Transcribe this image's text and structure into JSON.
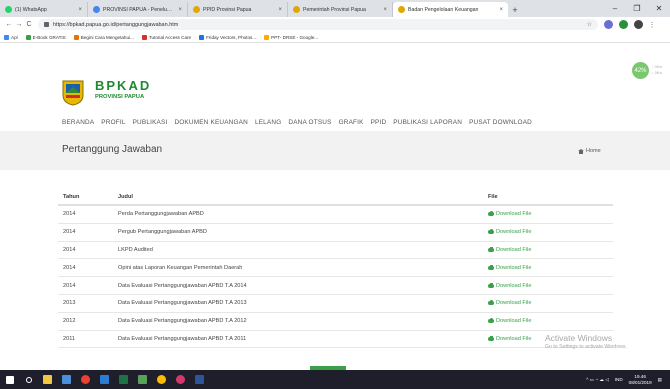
{
  "browser": {
    "tabs": [
      {
        "label": "(1) WhatsApp",
        "favicon_color": "#25d366",
        "active": false
      },
      {
        "label": "PROVINSI PAPUA - Penelusuran",
        "favicon_color": "#4285f4",
        "active": false
      },
      {
        "label": "PPID Provinsi Papua",
        "favicon_color": "#e0a800",
        "active": false
      },
      {
        "label": "Pemerintah Provinsi Papua",
        "favicon_color": "#e0a800",
        "active": false
      },
      {
        "label": "Badan Pengelolaan Keuangan",
        "favicon_color": "#e0a800",
        "active": true
      }
    ],
    "new_tab": "+",
    "url": "https://bpkad.papua.go.id/pertanggungjawaban.htm",
    "bookmarks": [
      {
        "label": "Apl",
        "color": "#4285f4"
      },
      {
        "label": "E-Book GRATIS",
        "color": "#3aa14a"
      },
      {
        "label": "Begini Cara Mengetahui...",
        "color": "#e8710a"
      },
      {
        "label": "Tutorial Access Care",
        "color": "#d93025"
      },
      {
        "label": "Friday Vectors, Photos...",
        "color": "#1a73e8"
      },
      {
        "label": "PPT- DRSE - Google...",
        "color": "#f9ab00"
      }
    ]
  },
  "site": {
    "logo_title": "BPKAD",
    "logo_subtitle": "PROVINSI PAPUA",
    "menu": [
      "BERANDA",
      "PROFIL",
      "PUBLIKASI",
      "DOKUMEN KEUANGAN",
      "LELANG",
      "DANA OTSUS",
      "GRAFIK",
      "PPID",
      "PUBLIKASI LAPORAN",
      "PUSAT DOWNLOAD"
    ],
    "speed": {
      "value": "42%",
      "up": "↑ 0K/s",
      "down": "↓ 0K/s"
    }
  },
  "page": {
    "title": "Pertanggung Jawaban",
    "breadcrumb": "Home"
  },
  "table": {
    "headers": [
      "Tahun",
      "Judul",
      "File"
    ],
    "rows": [
      {
        "tahun": "2014",
        "judul": "Perda Pertanggungjawaban APBD",
        "file": "Download File"
      },
      {
        "tahun": "2014",
        "judul": "Pergub Pertanggungjawaban APBD",
        "file": "Download File"
      },
      {
        "tahun": "2014",
        "judul": "LKPD Audited",
        "file": "Download File"
      },
      {
        "tahun": "2014",
        "judul": "Opini atas Laporan Keuangan Pemerintah Daerah",
        "file": "Download File"
      },
      {
        "tahun": "2014",
        "judul": "Data Evaluasi Pertanggungjawaban APBD T.A 2014",
        "file": "Download File"
      },
      {
        "tahun": "2013",
        "judul": "Data Evaluasi Pertanggungjawaban APBD T.A 2013",
        "file": "Download File"
      },
      {
        "tahun": "2012",
        "judul": "Data Evaluasi Pertanggungjawaban APBD T.A 2012",
        "file": "Download File"
      },
      {
        "tahun": "2011",
        "judul": "Data Evaluasi Pertanggungjawaban APBD T.A 2011",
        "file": "Download File"
      }
    ]
  },
  "watermark": {
    "line1": "Activate Windows",
    "line2": "Go to Settings to activate Windows."
  },
  "taskbar": {
    "language": "IND",
    "time": "19.46",
    "date": "08/01/2019"
  }
}
